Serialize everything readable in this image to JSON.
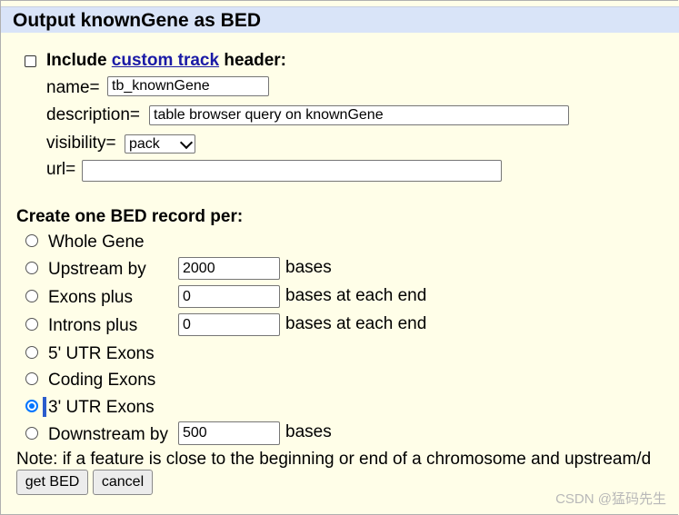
{
  "title": "Output knownGene as BED",
  "header": {
    "include_prefix": "Include ",
    "custom_track_link": "custom track",
    "include_suffix": " header:",
    "name_label": "name=",
    "name_value": "tb_knownGene",
    "description_label": "description=",
    "description_value": "table browser query on knownGene",
    "visibility_label": "visibility=",
    "visibility_value": "pack",
    "url_label": "url=",
    "url_value": ""
  },
  "record_heading": "Create one BED record per:",
  "options": [
    {
      "label": "Whole Gene",
      "checked": false
    },
    {
      "label": "Upstream by",
      "checked": false,
      "value": "2000",
      "suffix": "bases"
    },
    {
      "label": "Exons plus",
      "checked": false,
      "value": "0",
      "suffix": "bases at each end"
    },
    {
      "label": "Introns plus",
      "checked": false,
      "value": "0",
      "suffix": "bases at each end"
    },
    {
      "label": "5' UTR Exons",
      "checked": false
    },
    {
      "label": "Coding Exons",
      "checked": false
    },
    {
      "label": "3' UTR Exons",
      "checked": true
    },
    {
      "label": "Downstream by",
      "checked": false,
      "value": "500",
      "suffix": "bases"
    }
  ],
  "note": "Note: if a feature is close to the beginning or end of a chromosome and upstream/d",
  "buttons": {
    "get_bed": "get BED",
    "cancel": "cancel"
  },
  "watermark": "CSDN @猛码先生",
  "colors": {
    "title_bar": "#d9e4f8",
    "page_bg": "#fffee8",
    "link": "#1a1aa6",
    "radio_selected": "#0075ff"
  }
}
